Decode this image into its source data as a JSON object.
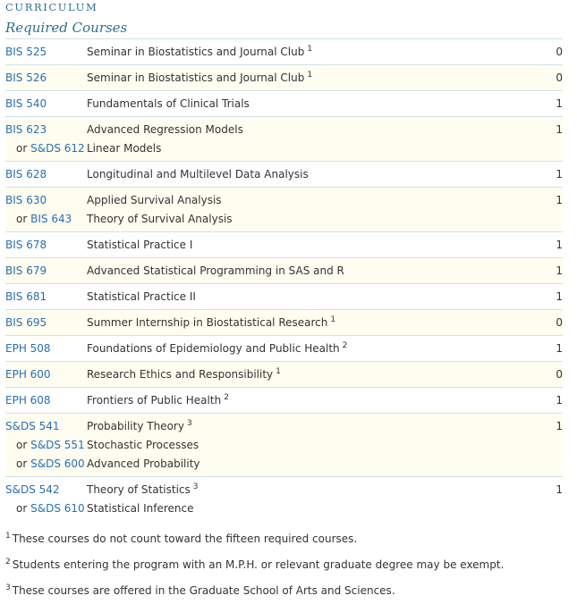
{
  "section_label": "CURRICULUM",
  "section_title": "Required Courses",
  "courses": [
    {
      "code": "BIS 525",
      "title": "Seminar in Biostatistics and Journal Club",
      "note": "1",
      "credits": "0"
    },
    {
      "code": "BIS 526",
      "title": "Seminar in Biostatistics and Journal Club",
      "note": "1",
      "credits": "0"
    },
    {
      "code": "BIS 540",
      "title": "Fundamentals of Clinical Trials",
      "credits": "1"
    },
    {
      "code": "BIS 623",
      "title": "Advanced Regression Models",
      "credits": "1",
      "or_word": "or",
      "alt_code": "S&DS 612",
      "alt_title": "Linear Models"
    },
    {
      "code": "BIS 628",
      "title": "Longitudinal and Multilevel Data Analysis",
      "credits": "1"
    },
    {
      "code": "BIS 630",
      "title": "Applied Survival Analysis",
      "credits": "1",
      "or_word": "or",
      "alt_code": "BIS 643",
      "alt_title": "Theory of Survival Analysis"
    },
    {
      "code": "BIS 678",
      "title": "Statistical Practice I",
      "credits": "1"
    },
    {
      "code": "BIS 679",
      "title": "Advanced Statistical Programming in SAS and R",
      "credits": "1"
    },
    {
      "code": "BIS 681",
      "title": "Statistical Practice II",
      "credits": "1"
    },
    {
      "code": "BIS 695",
      "title": "Summer Internship in Biostatistical Research",
      "note": "1",
      "credits": "0"
    },
    {
      "code": "EPH 508",
      "title": "Foundations of Epidemiology and Public Health",
      "note": "2",
      "credits": "1"
    },
    {
      "code": "EPH 600",
      "title": "Research Ethics and Responsibility",
      "note": "1",
      "credits": "0"
    },
    {
      "code": "EPH 608",
      "title": "Frontiers of Public Health",
      "note": "2",
      "credits": "1"
    },
    {
      "code": "S&DS 541",
      "title": "Probability Theory",
      "note": "3",
      "credits": "1",
      "or_word": "or",
      "alt_code": "S&DS 551",
      "alt_title": "Stochastic Processes",
      "alt_code_2": "S&DS 600",
      "alt_title_2": "Advanced Probability"
    },
    {
      "code": "S&DS 542",
      "title": "Theory of Statistics",
      "note": "3",
      "credits": "1",
      "or_word": "or",
      "alt_code": "S&DS 610",
      "alt_title": "Statistical Inference"
    }
  ],
  "footnotes": [
    {
      "mark": "1",
      "text": "These courses do not count toward the fifteen required courses."
    },
    {
      "mark": "2",
      "text": "Students entering the program with an M.P.H. or relevant graduate degree may be exempt."
    },
    {
      "mark": "3",
      "text": "These courses are offered in the Graduate School of Arts and Sciences."
    }
  ],
  "colors": {
    "link": "#2a6fb0",
    "heading": "#2f6f8f",
    "row_highlight": "#fefdf0",
    "rule": "#cfe3e8"
  }
}
